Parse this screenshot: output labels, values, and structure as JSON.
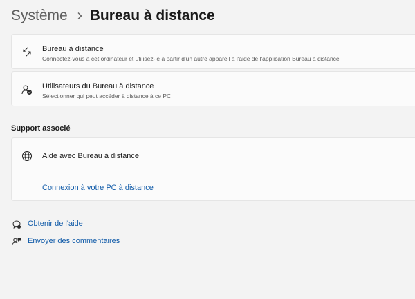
{
  "breadcrumb": {
    "parent": "Système",
    "current": "Bureau à distance"
  },
  "settings": {
    "remote_desktop": {
      "title": "Bureau à distance",
      "description": "Connectez-vous à cet ordinateur et utilisez-le à partir d'un autre appareil à l'aide de l'application Bureau à distance",
      "icon": "remote-desktop-icon"
    },
    "remote_users": {
      "title": "Utilisateurs du Bureau à distance",
      "description": "Sélectionner qui peut accéder à distance à ce PC",
      "icon": "users-icon"
    }
  },
  "support": {
    "section_title": "Support associé",
    "help_title": "Aide avec Bureau à distance",
    "help_icon": "globe-icon",
    "link": "Connexion à votre PC à distance"
  },
  "footer": {
    "get_help": "Obtenir de l'aide",
    "get_help_icon": "help-icon",
    "feedback": "Envoyer des commentaires",
    "feedback_icon": "feedback-icon"
  },
  "colors": {
    "background": "#f3f3f3",
    "card": "#fbfbfb",
    "link": "#0f5aa8",
    "text": "#1b1b1b",
    "secondary_text": "#5d5d5d"
  }
}
